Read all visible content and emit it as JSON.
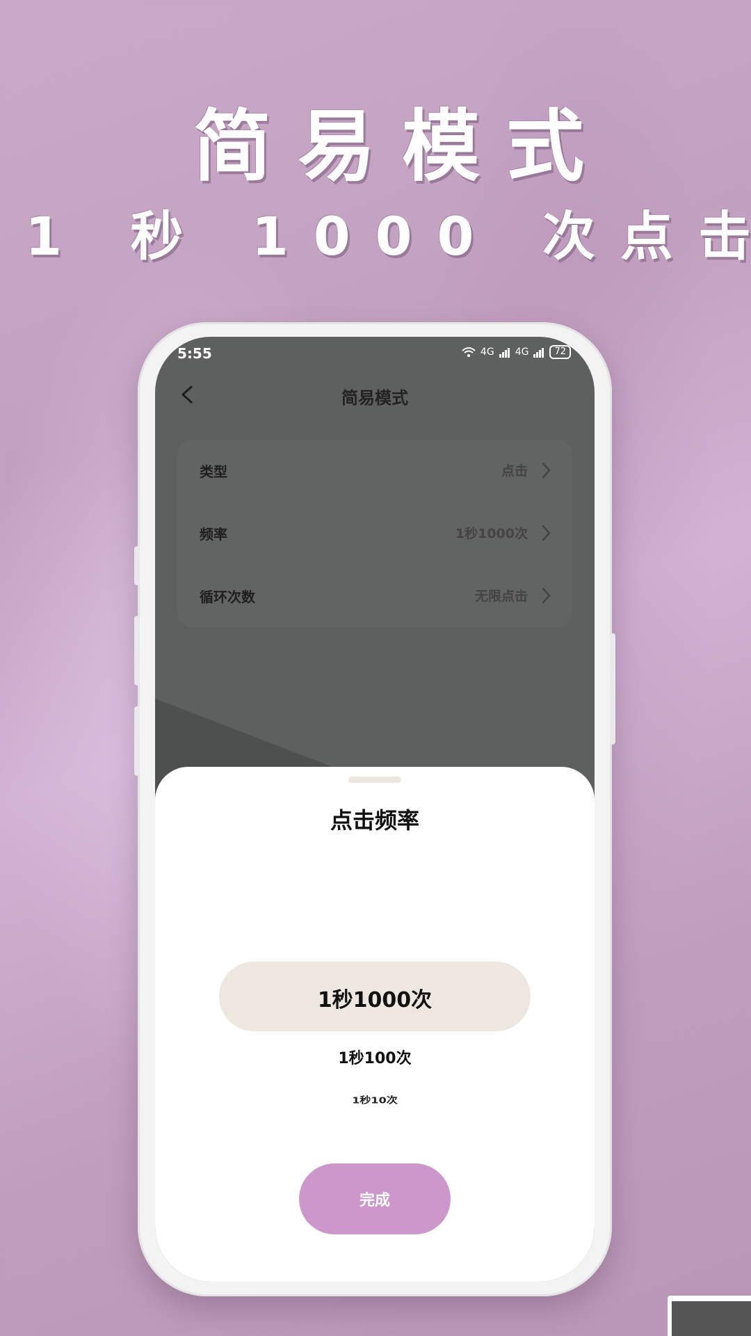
{
  "promo": {
    "title": "简易模式",
    "subtitle": "1 秒 1000 次点击"
  },
  "status_bar": {
    "time": "5:55",
    "signal_text": "4G",
    "signal_text_2": "4G",
    "battery": "72"
  },
  "nav": {
    "title": "简易模式"
  },
  "settings": [
    {
      "label": "类型",
      "value": "点击"
    },
    {
      "label": "频率",
      "value": "1秒1000次"
    },
    {
      "label": "循环次数",
      "value": "无限点击"
    }
  ],
  "sheet": {
    "title": "点击频率",
    "options": [
      "1秒1000次",
      "1秒100次",
      "1秒10次"
    ],
    "selected_index": 0,
    "done_label": "完成"
  },
  "colors": {
    "accent": "#cc98cc",
    "selected_bg": "#ede7e0",
    "background": "#c4a2c2"
  }
}
